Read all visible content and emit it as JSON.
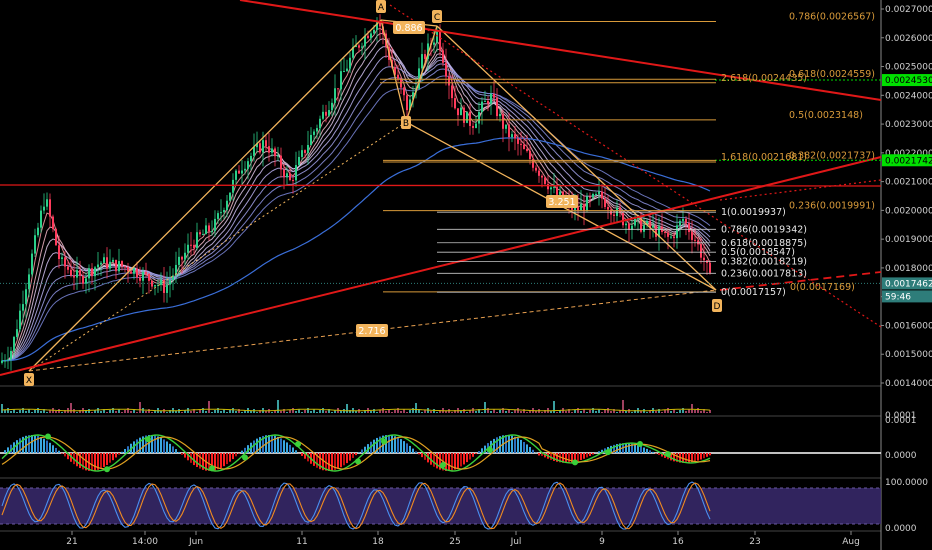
{
  "chart_data": {
    "type": "candlestick",
    "price_axis": {
      "ticks": [
        "0.0027000",
        "0.0026000",
        "0.0025000",
        "0.0024000",
        "0.0023000",
        "0.0022000",
        "0.0021000",
        "0.0020000",
        "0.0019000",
        "0.0018000",
        "0.0017000",
        "0.0016000",
        "0.0015000",
        "0.0014000"
      ],
      "ylim": [
        0.00137,
        0.00271
      ]
    },
    "time_axis": {
      "ticks": [
        "21",
        "14:00",
        "Jun",
        "11",
        "18",
        "25",
        "Jul",
        "9",
        "16",
        "23",
        "Aug"
      ]
    },
    "price_tags": [
      {
        "text": "0.0024530",
        "color": "#00e000",
        "value": 0.002453
      },
      {
        "text": "0.0021742",
        "color": "#00e000",
        "value": 0.0021742
      },
      {
        "text": "0.0017462",
        "color": "#2e7d7a",
        "value": 0.0017462
      },
      {
        "text": "59:46",
        "color": "#2e7d7a",
        "value": 0.0017462
      }
    ],
    "pattern_points": [
      "X",
      "A",
      "B",
      "C",
      "D"
    ],
    "pattern_ratios": [
      "0.886",
      "3.251",
      "2.716"
    ],
    "fib_upper": [
      {
        "label": "0.786(0.0026567)",
        "value": 0.0026567
      },
      {
        "label": "0.618(0.0024559)",
        "value": 0.0024559
      },
      {
        "label": "2.618(0.0024435)",
        "value": 0.0024435
      },
      {
        "label": "0.5(0.0023148)",
        "value": 0.0023148
      },
      {
        "label": "0.382(0.0021737)",
        "value": 0.0021737
      },
      {
        "label": "1.618(0.0021681)",
        "value": 0.0021681
      },
      {
        "label": "0.236(0.0019991)",
        "value": 0.0019991
      },
      {
        "label": "0(0.0017169)",
        "value": 0.0017169
      }
    ],
    "fib_lower": [
      {
        "label": "1(0.0019937)",
        "value": 0.0019937
      },
      {
        "label": "0.786(0.0019342)",
        "value": 0.0019342
      },
      {
        "label": "0.618(0.0018875)",
        "value": 0.0018875
      },
      {
        "label": "0.5(0.0018547)",
        "value": 0.0018547
      },
      {
        "label": "0.382(0.0018219)",
        "value": 0.0018219
      },
      {
        "label": "0.236(0.0017813)",
        "value": 0.0017813
      },
      {
        "label": "0(0.0017157)",
        "value": 0.0017157
      }
    ],
    "indicator_ticks": {
      "volume": [
        "0.0001"
      ],
      "macd": [
        "0.0001",
        "0.0000"
      ],
      "stoch": [
        "100.0000",
        "0.0000"
      ]
    }
  }
}
